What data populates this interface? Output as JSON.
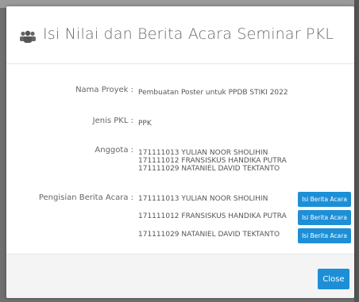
{
  "modal": {
    "title": "Isi Nilai dan Berita Acara Seminar PKL",
    "icon": "users-icon"
  },
  "fields": {
    "nama_proyek": {
      "label": "Nama Proyek :",
      "value": "Pembuatan Poster untuk PPDB STIKI 2022"
    },
    "jenis_pkl": {
      "label": "Jenis PKL :",
      "value": "PPK"
    },
    "anggota": {
      "label": "Anggota :",
      "members": [
        "171111013 YULIAN NOOR SHOLIHIN",
        "171111012 FRANSISKUS HANDIKA PUTRA",
        "171111029 NATANIEL DAVID TEKTANTO"
      ]
    },
    "pengisian": {
      "label": "Pengisian Berita Acara :",
      "rows": [
        {
          "member": "171111013 YULIAN NOOR SHOLIHIN",
          "button": "Isi Berita Acara"
        },
        {
          "member": "171111012 FRANSISKUS HANDIKA PUTRA",
          "button": "Isi Berita Acara"
        },
        {
          "member": "171111029 NATANIEL DAVID TEKTANTO",
          "button": "Isi Berita Acara"
        }
      ]
    }
  },
  "footer": {
    "close_label": "Close"
  },
  "colors": {
    "primary": "#1d8fd6",
    "backdrop": "#6f6f6f",
    "footer_bg": "#f4f4f4"
  }
}
